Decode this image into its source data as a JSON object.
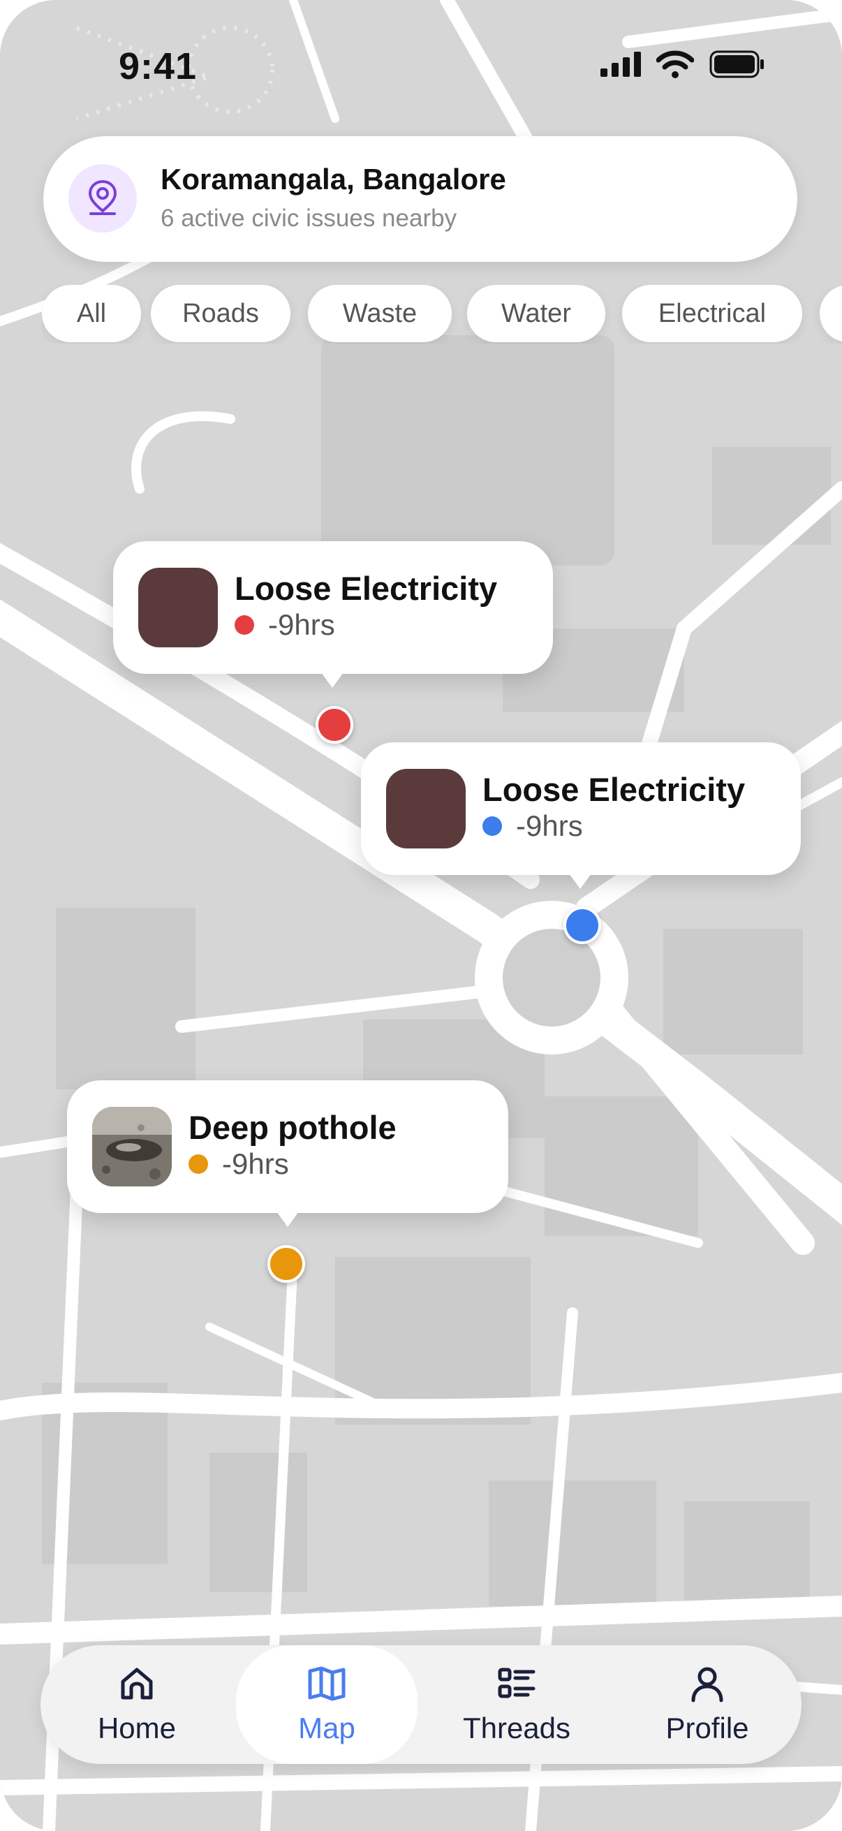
{
  "status_bar": {
    "time": "9:41"
  },
  "location": {
    "title": "Koramangala, Bangalore",
    "subtitle": "6 active civic issues nearby"
  },
  "filters": [
    "All",
    "Roads",
    "Waste",
    "Water",
    "Electrical"
  ],
  "issues": [
    {
      "title": "Loose Electricity",
      "time": "-9hrs",
      "status_color": "#e53e3e"
    },
    {
      "title": "Loose Electricity",
      "time": "-9hrs",
      "status_color": "#3b7ded"
    },
    {
      "title": "Deep pothole",
      "time": "-9hrs",
      "status_color": "#e8960c"
    }
  ],
  "nav": [
    {
      "label": "Home",
      "icon": "home-icon",
      "active": false
    },
    {
      "label": "Map",
      "icon": "map-icon",
      "active": true
    },
    {
      "label": "Threads",
      "icon": "threads-icon",
      "active": false
    },
    {
      "label": "Profile",
      "icon": "profile-icon",
      "active": false
    }
  ],
  "colors": {
    "accent": "#4a7cf0",
    "location_icon": "#7a3fd6",
    "thumb": "#5a3a3a"
  }
}
